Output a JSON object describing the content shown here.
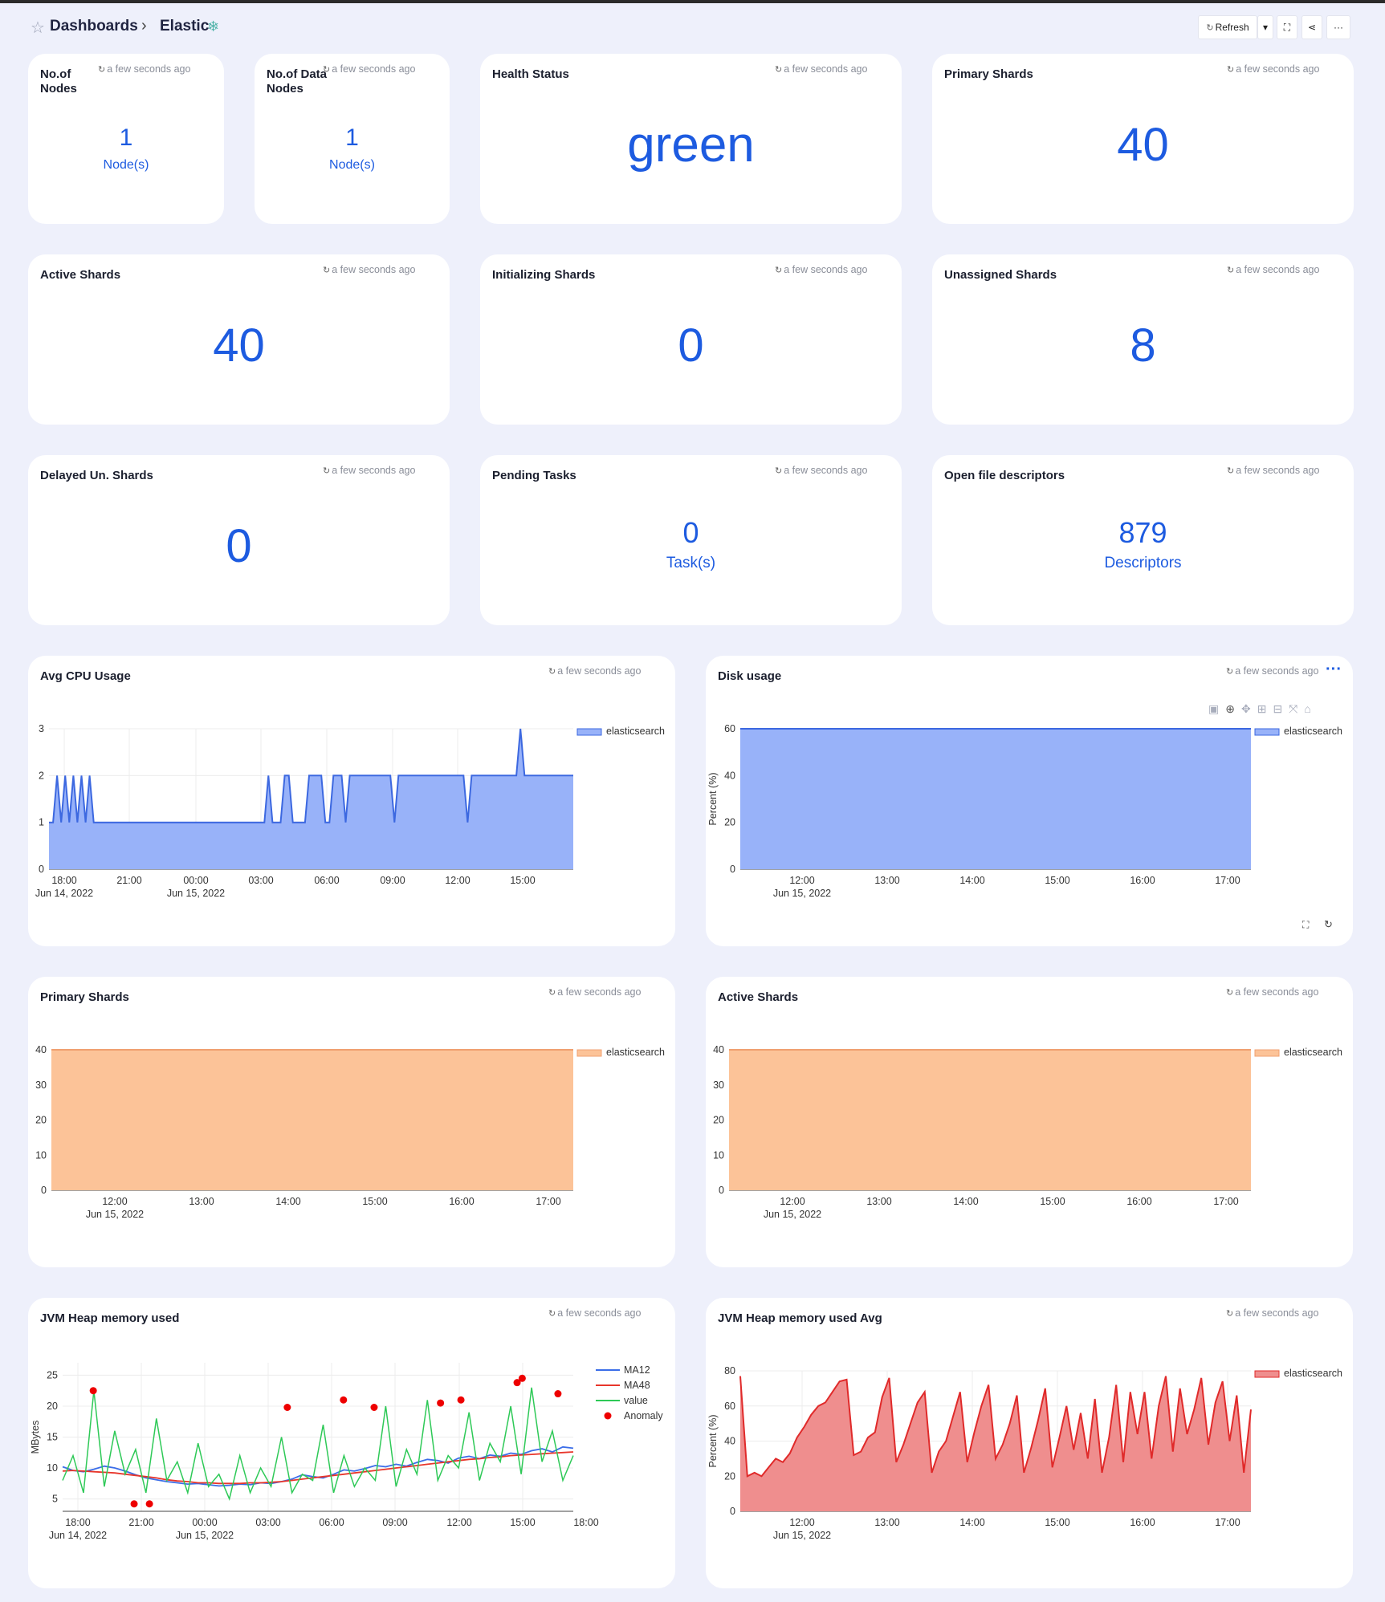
{
  "breadcrumb": {
    "root": "Dashboards",
    "current": "Elastic"
  },
  "toolbar": {
    "refresh_label": "Refresh",
    "more_label": "···"
  },
  "updated": "a few seconds ago",
  "stats": {
    "nodes": {
      "title": "No.of Nodes",
      "value": "1",
      "unit": "Node(s)"
    },
    "data_nodes": {
      "title": "No.of Data Nodes",
      "value": "1",
      "unit": "Node(s)"
    },
    "health": {
      "title": "Health Status",
      "value": "green"
    },
    "primary": {
      "title": "Primary Shards",
      "value": "40"
    },
    "active": {
      "title": "Active Shards",
      "value": "40"
    },
    "initializing": {
      "title": "Initializing Shards",
      "value": "0"
    },
    "unassigned": {
      "title": "Unassigned Shards",
      "value": "8"
    },
    "delayed": {
      "title": "Delayed Un. Shards",
      "value": "0"
    },
    "pending": {
      "title": "Pending Tasks",
      "value": "0",
      "unit": "Task(s)"
    },
    "fds": {
      "title": "Open file descriptors",
      "value": "879",
      "unit": "Descriptors"
    }
  },
  "colors": {
    "accent": "#1d5be0",
    "blue_fill": "#98b2f9",
    "blue_line": "#3c68e0",
    "orange_fill": "#fcc398",
    "orange_line": "#f0a070",
    "red_fill": "#ef8e8e",
    "red_line": "#e02a2a",
    "green": "#2ec957"
  },
  "chart_data": [
    {
      "title": "Avg CPU Usage",
      "type": "area",
      "ylim": [
        0,
        3
      ],
      "yticks": [
        "0",
        "1",
        "2",
        "3"
      ],
      "xticks": [
        "18:00",
        "21:00",
        "00:00",
        "03:00",
        "06:00",
        "09:00",
        "12:00",
        "15:00"
      ],
      "xsub": [
        "Jun 14, 2022",
        "Jun 15, 2022"
      ],
      "series": [
        {
          "name": "elasticsearch",
          "values": [
            1,
            1,
            2,
            1,
            2,
            1,
            2,
            1,
            2,
            1,
            2,
            1,
            1,
            1,
            1,
            1,
            1,
            1,
            1,
            1,
            1,
            1,
            1,
            1,
            1,
            1,
            1,
            1,
            1,
            1,
            1,
            1,
            1,
            1,
            1,
            1,
            1,
            1,
            1,
            1,
            1,
            1,
            1,
            1,
            1,
            1,
            1,
            1,
            1,
            1,
            1,
            1,
            1,
            1,
            2,
            1,
            1,
            1,
            2,
            2,
            1,
            1,
            1,
            1,
            2,
            2,
            2,
            2,
            1,
            1,
            2,
            2,
            2,
            1,
            2,
            2,
            2,
            2,
            2,
            2,
            2,
            2,
            2,
            2,
            2,
            1,
            2,
            2,
            2,
            2,
            2,
            2,
            2,
            2,
            2,
            2,
            2,
            2,
            2,
            2,
            2,
            2,
            2,
            1,
            2,
            2,
            2,
            2,
            2,
            2,
            2,
            2,
            2,
            2,
            2,
            2,
            3,
            2,
            2,
            2,
            2,
            2,
            2,
            2,
            2,
            2,
            2,
            2,
            2,
            2
          ]
        }
      ]
    },
    {
      "title": "Disk usage",
      "type": "area",
      "ylim": [
        0,
        60
      ],
      "ylabel": "Percent (%)",
      "yticks": [
        "0",
        "20",
        "40",
        "60"
      ],
      "xticks": [
        "12:00",
        "13:00",
        "14:00",
        "15:00",
        "16:00",
        "17:00"
      ],
      "xsub": [
        "Jun 15, 2022"
      ],
      "series": [
        {
          "name": "elasticsearch",
          "values": [
            60,
            60
          ]
        }
      ]
    },
    {
      "title": "Primary Shards",
      "type": "area",
      "ylim": [
        0,
        40
      ],
      "yticks": [
        "0",
        "10",
        "20",
        "30",
        "40"
      ],
      "xticks": [
        "12:00",
        "13:00",
        "14:00",
        "15:00",
        "16:00",
        "17:00"
      ],
      "xsub": [
        "Jun 15, 2022"
      ],
      "series": [
        {
          "name": "elasticsearch",
          "values": [
            40,
            40
          ]
        }
      ]
    },
    {
      "title": "Active Shards",
      "type": "area",
      "ylim": [
        0,
        40
      ],
      "yticks": [
        "0",
        "10",
        "20",
        "30",
        "40"
      ],
      "xticks": [
        "12:00",
        "13:00",
        "14:00",
        "15:00",
        "16:00",
        "17:00"
      ],
      "xsub": [
        "Jun 15, 2022"
      ],
      "series": [
        {
          "name": "elasticsearch",
          "values": [
            40,
            40
          ]
        }
      ]
    },
    {
      "title": "JVM Heap memory used",
      "type": "line",
      "ylabel": "MBytes",
      "ylim": [
        3,
        27
      ],
      "yticks": [
        "5",
        "10",
        "15",
        "20",
        "25"
      ],
      "xticks": [
        "18:00",
        "21:00",
        "00:00",
        "03:00",
        "06:00",
        "09:00",
        "12:00",
        "15:00",
        "18:00"
      ],
      "xsub": [
        "Jun 14, 2022",
        "Jun 15, 2022"
      ],
      "series": [
        {
          "name": "MA12",
          "values": [
            10.2,
            9.6,
            9.4,
            9.8,
            10.3,
            10,
            9.5,
            8.9,
            8.4,
            8.1,
            7.8,
            7.6,
            7.4,
            7.5,
            7.3,
            7.1,
            7.2,
            7.4,
            7.3,
            7.6,
            7.5,
            7.8,
            8.2,
            8.9,
            8.6,
            8.4,
            9,
            9.7,
            9.5,
            9.9,
            10.4,
            10.2,
            10.6,
            10.3,
            10.9,
            11.4,
            11.2,
            10.8,
            11.6,
            11.9,
            11.5,
            12.1,
            11.9,
            12.4,
            12.2,
            12.8,
            13.1,
            12.6,
            13.4,
            13.2
          ]
        },
        {
          "name": "MA48",
          "values": [
            9.5,
            9.6,
            9.5,
            9.4,
            9.3,
            9.2,
            9,
            8.8,
            8.6,
            8.4,
            8.1,
            7.9,
            7.8,
            7.6,
            7.6,
            7.5,
            7.5,
            7.5,
            7.6,
            7.6,
            7.7,
            7.8,
            8,
            8.2,
            8.4,
            8.6,
            8.8,
            9,
            9.2,
            9.4,
            9.6,
            9.8,
            10,
            10.2,
            10.4,
            10.6,
            10.8,
            11,
            11.2,
            11.4,
            11.5,
            11.7,
            11.8,
            12,
            12.1,
            12.2,
            12.3,
            12.4,
            12.5,
            12.6
          ]
        },
        {
          "name": "value",
          "values": [
            8,
            12,
            6,
            22.5,
            7,
            16,
            9,
            13,
            6,
            18,
            8,
            11,
            6,
            14,
            7,
            9,
            5,
            12,
            6,
            10,
            7,
            15,
            6,
            9,
            8,
            17,
            6,
            12,
            7,
            10,
            8,
            20,
            7,
            13,
            9,
            21,
            8,
            12,
            10,
            19,
            8,
            14,
            11,
            20,
            9,
            23,
            11,
            16,
            8,
            12
          ]
        },
        {
          "name": "Anomaly",
          "values": [
            22.5,
            4.2,
            4.2,
            19.8,
            21,
            19.8,
            20.5,
            21,
            23.8,
            24.5,
            22
          ]
        }
      ]
    },
    {
      "title": "JVM Heap memory used Avg",
      "type": "area",
      "ylabel": "Percent (%)",
      "ylim": [
        0,
        80
      ],
      "yticks": [
        "0",
        "20",
        "40",
        "60",
        "80"
      ],
      "xticks": [
        "12:00",
        "13:00",
        "14:00",
        "15:00",
        "16:00",
        "17:00"
      ],
      "xsub": [
        "Jun 15, 2022"
      ],
      "series": [
        {
          "name": "elasticsearch",
          "values": [
            77,
            20,
            22,
            20,
            25,
            30,
            28,
            33,
            42,
            48,
            55,
            60,
            62,
            68,
            74,
            75,
            32,
            34,
            42,
            45,
            65,
            76,
            28,
            38,
            50,
            62,
            68,
            22,
            34,
            40,
            54,
            68,
            28,
            45,
            60,
            72,
            30,
            38,
            50,
            66,
            22,
            36,
            52,
            70,
            25,
            42,
            60,
            35,
            56,
            30,
            64,
            22,
            42,
            72,
            28,
            68,
            44,
            68,
            30,
            60,
            77,
            34,
            70,
            44,
            58,
            76,
            38,
            62,
            74,
            40,
            66,
            22,
            58
          ]
        }
      ]
    }
  ]
}
